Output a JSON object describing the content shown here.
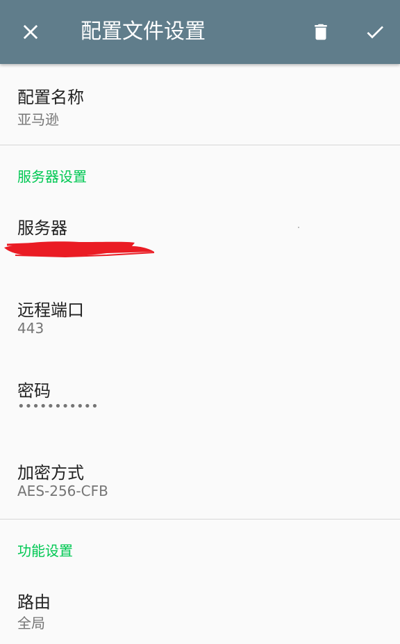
{
  "toolbar": {
    "title": "配置文件设置",
    "close_icon": "close-icon",
    "delete_icon": "trash-icon",
    "save_icon": "check-icon",
    "background": "#607d8b"
  },
  "profile": {
    "name_title": "配置名称",
    "name_value": "亚马逊"
  },
  "server_settings": {
    "header": "服务器设置",
    "header_color": "#00c853",
    "server_title": "服务器",
    "server_value_redacted": true,
    "port_title": "远程端口",
    "port_value": "443",
    "password_title": "密码",
    "password_value": "•••••••••••",
    "encryption_title": "加密方式",
    "encryption_value": "AES-256-CFB"
  },
  "feature_settings": {
    "header": "功能设置",
    "route_title": "路由",
    "route_value": "全局"
  }
}
